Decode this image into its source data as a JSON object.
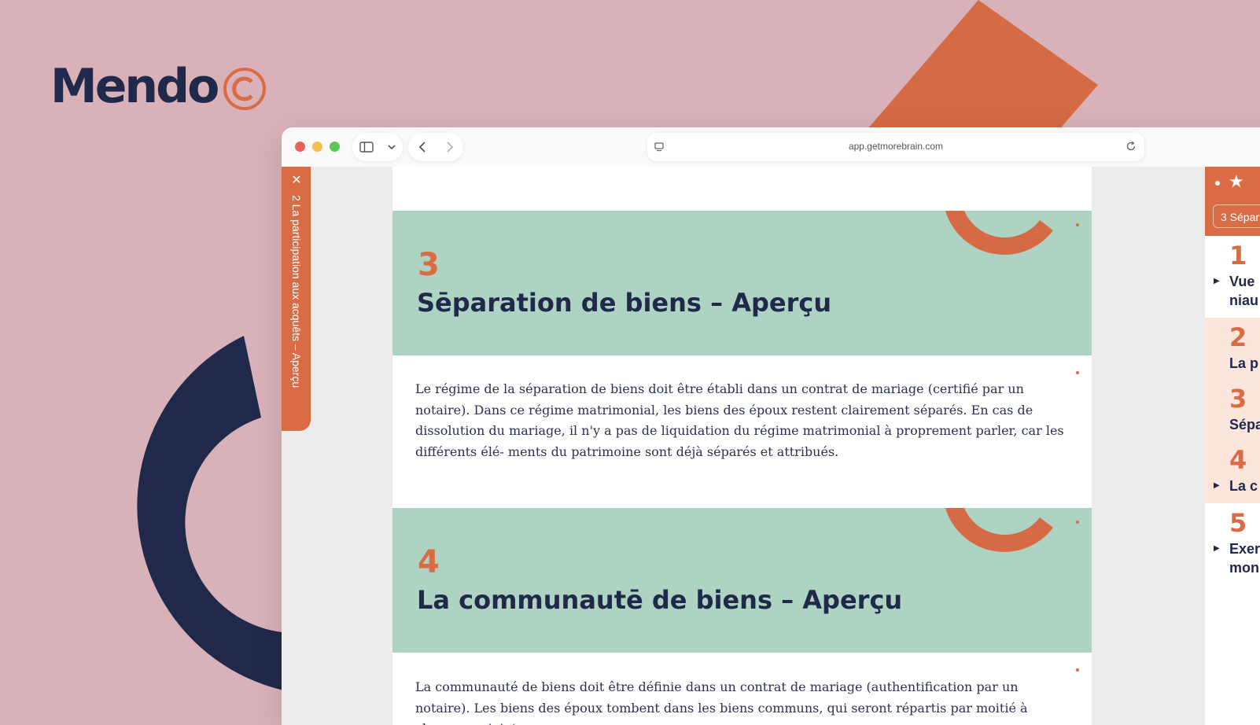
{
  "brand": {
    "name": "Mendo",
    "colors": {
      "background": "#d8b2b8",
      "navy": "#21294b",
      "orange": "#d96c45",
      "mint": "#aed3c3"
    }
  },
  "browser": {
    "url": "app.getmorebrain.com"
  },
  "left_tab": {
    "label": "2 La participation aux acquêts – Aperçu"
  },
  "document": {
    "sections": [
      {
        "number": "3",
        "title": "Sēparation de biens – Aperçu",
        "body": "Le régime de la séparation de biens doit être établi dans un contrat de mariage (certifié par un notaire). Dans ce régime matrimonial, les biens des époux restent clairement séparés. En cas de dissolution du mariage, il n'y a pas de liquidation du régime matrimonial à proprement parler, car les différents élé- ments du patrimoine sont déjà séparés et attribués."
      },
      {
        "number": "4",
        "title": "La communautē de biens – Aperçu",
        "body": "La communauté de biens doit être définie dans un contrat de mariage (authentification par un notaire). Les biens des époux tombent dans les biens communs, qui seront répartis par moitié à chaque conjoint"
      }
    ]
  },
  "right_panel": {
    "chip": "3 Sépar",
    "items": [
      {
        "number": "1",
        "line1": "Vue",
        "line2": "niau"
      },
      {
        "number": "2",
        "line1": "La p"
      },
      {
        "number": "3",
        "line1": "Sépa"
      },
      {
        "number": "4",
        "line1": "La c"
      },
      {
        "number": "5",
        "line1": "Exer",
        "line2": "mon"
      }
    ]
  }
}
